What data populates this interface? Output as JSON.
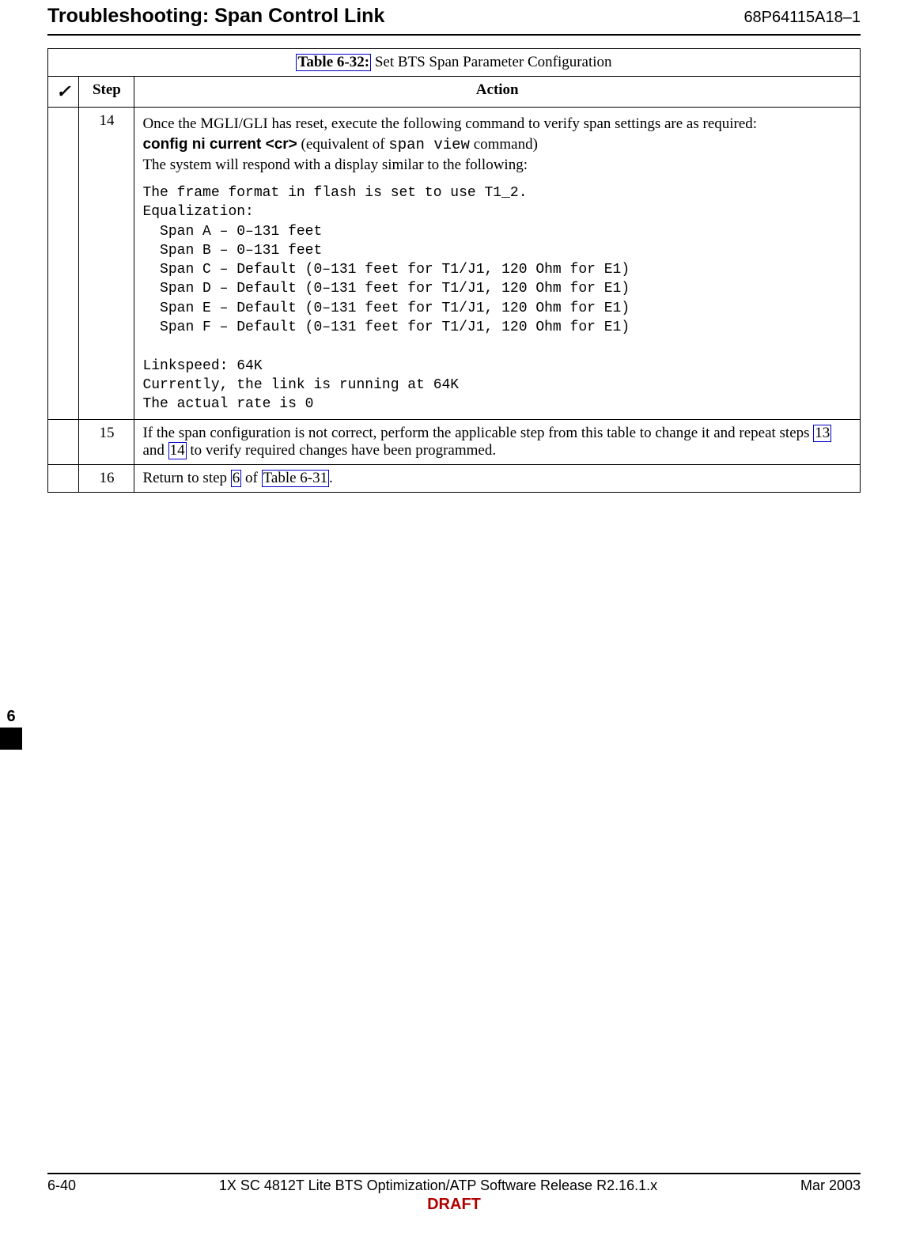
{
  "header": {
    "title": "Troubleshooting: Span Control Link",
    "doc": "68P64115A18–1"
  },
  "table": {
    "number": "Table 6-32:",
    "title": "Set BTS Span Parameter Configuration",
    "check_header": "✓",
    "step_header": "Step",
    "action_header": "Action",
    "rows": [
      {
        "step": "14",
        "intro": "Once the MGLI/GLI has reset, execute the following command to verify span settings are as required:",
        "cmd": "config  ni  current  <cr>",
        "cmd_note_pre": "  (equivalent of ",
        "cmd_note_code": "span view",
        "cmd_note_post": " command)",
        "respond": "The system will respond with a display similar to the following:",
        "output": "The frame format in flash is set to use T1_2.\nEqualization:\n  Span A – 0–131 feet\n  Span B – 0–131 feet\n  Span C – Default (0–131 feet for T1/J1, 120 Ohm for E1)\n  Span D – Default (0–131 feet for T1/J1, 120 Ohm for E1)\n  Span E – Default (0–131 feet for T1/J1, 120 Ohm for E1)\n  Span F – Default (0–131 feet for T1/J1, 120 Ohm for E1)\n\nLinkspeed: 64K\nCurrently, the link is running at 64K\nThe actual rate is 0"
      },
      {
        "step": "15",
        "text_pre": "If the span configuration is not correct, perform the applicable step from this table to change it and repeat steps ",
        "link1": "13",
        "text_mid": " and ",
        "link2": "14",
        "text_post": " to verify required changes have been programmed."
      },
      {
        "step": "16",
        "text_pre": "Return to step ",
        "link1": "6",
        "text_mid": " of ",
        "link2": "Table 6-31",
        "text_post": "."
      }
    ]
  },
  "side": {
    "chapter": "6"
  },
  "footer": {
    "page": "6-40",
    "center": "1X SC 4812T Lite BTS Optimization/ATP Software Release R2.16.1.x",
    "date": "Mar 2003",
    "draft": "DRAFT"
  }
}
